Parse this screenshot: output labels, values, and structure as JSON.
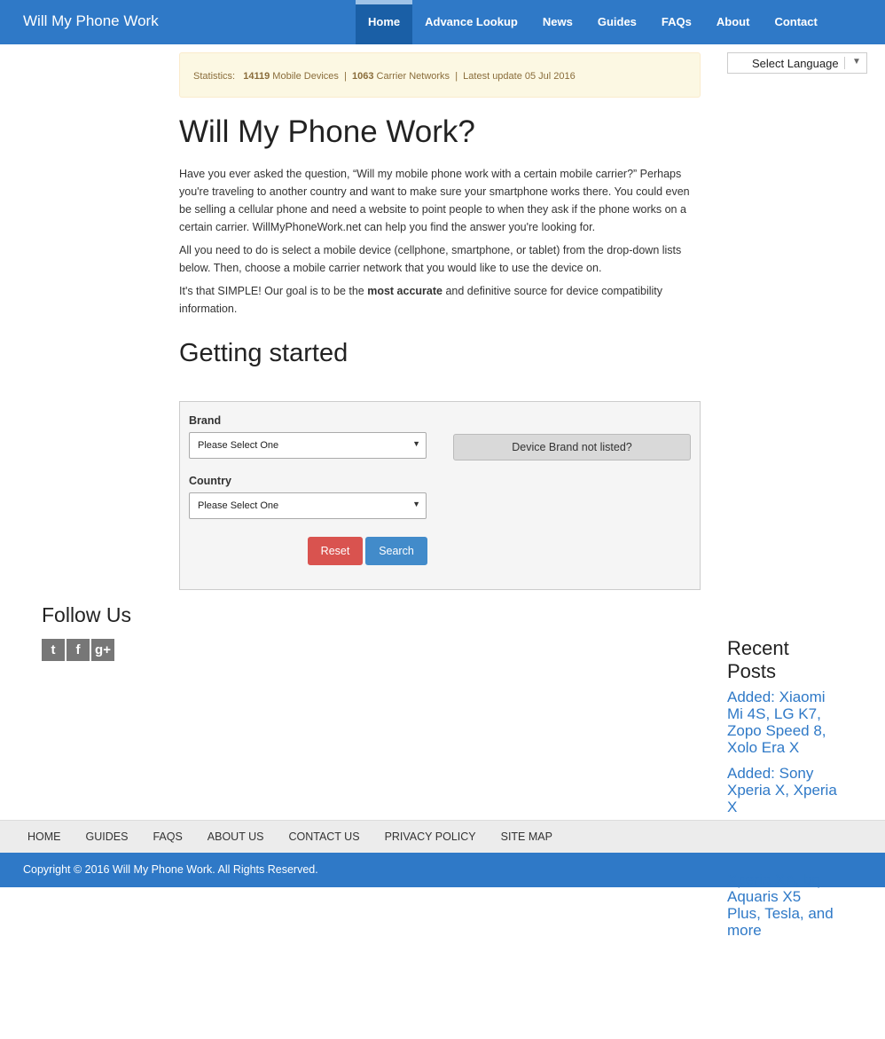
{
  "site": {
    "name": "Will My Phone Work"
  },
  "nav": [
    "Home",
    "Advance Lookup",
    "News",
    "Guides",
    "FAQs",
    "About",
    "Contact"
  ],
  "language": {
    "label": "Select Language",
    "arrow": "▼"
  },
  "stats": {
    "prefix": "Statistics:",
    "devices": "14119",
    "devices_label": "Mobile Devices",
    "sep": "|",
    "carriers": "1063",
    "carriers_label": "Carrier Networks",
    "update": "Latest update 05 Jul 2016"
  },
  "intro": {
    "title": "Will My Phone Work?",
    "p1": "Have you ever asked the question, “Will my mobile phone work with a certain mobile carrier?” Perhaps you're traveling to another country and want to make sure your smartphone works there. You could even be selling a cellular phone and need a website to point people to when they ask if the phone works on a certain carrier. WillMyPhoneWork.net can help you find the answer you're looking for.",
    "p2": "All you need to do is select a mobile device (cellphone, smartphone, or tablet) from the drop-down lists below. Then, choose a mobile carrier network that you would like to use the device on.",
    "p3_a": "It's that SIMPLE! Our goal is to be the ",
    "p3_bold": "most accurate",
    "p3_b": " and definitive source for device compatibility information."
  },
  "getting_started": "Getting started",
  "form": {
    "brand_label": "Brand",
    "brand_value": "Please Select One",
    "country_label": "Country",
    "country_value": "Please Select One",
    "not_listed": "Device Brand not listed?",
    "reset": "Reset",
    "search": "Search"
  },
  "follow": {
    "title": "Follow Us",
    "icons": [
      "twitter-icon",
      "facebook-icon",
      "google-plus-icon"
    ]
  },
  "recent": {
    "title": "Recent Posts",
    "posts": [
      "Added: Xiaomi Mi 4S, LG K7, Zopo Speed 8, Xolo Era X",
      "Added: Sony Xperia X, Xperia X",
      "Xperia XA, bq Aquaris X5 Plus, Tesla, and more"
    ]
  },
  "footer": {
    "links": [
      "HOME",
      "GUIDES",
      "FAQS",
      "ABOUT US",
      "CONTACT US",
      "PRIVACY POLICY",
      "SITE MAP"
    ],
    "copyright": "Copyright © 2016 Will My Phone Work. All Rights Reserved."
  },
  "colors": {
    "primary": "#2f79c7",
    "reset": "#d9534f",
    "search": "#428bca",
    "alert_bg": "#fcf8e3"
  }
}
